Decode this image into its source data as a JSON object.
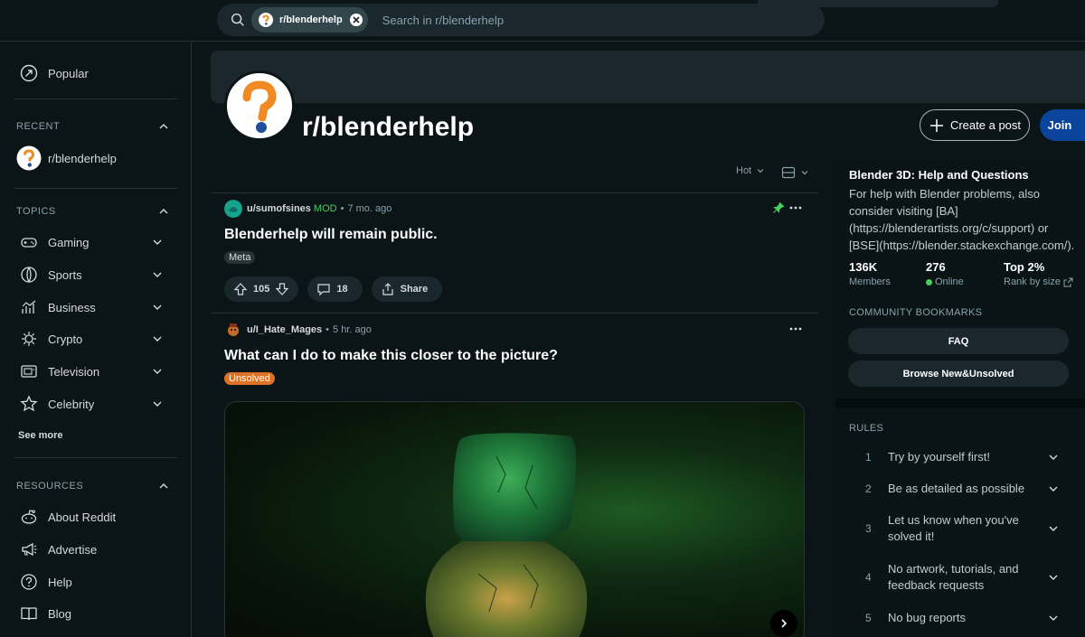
{
  "search": {
    "chip_label": "r/blenderhelp",
    "placeholder": "Search in r/blenderhelp"
  },
  "sidebar": {
    "popular_label": "Popular",
    "recent_heading": "RECENT",
    "recent_items": [
      {
        "label": "r/blenderhelp"
      }
    ],
    "topics_heading": "TOPICS",
    "topics": [
      {
        "label": "Gaming",
        "icon": "gamepad-icon"
      },
      {
        "label": "Sports",
        "icon": "sports-ball-icon"
      },
      {
        "label": "Business",
        "icon": "chart-icon"
      },
      {
        "label": "Crypto",
        "icon": "crypto-icon"
      },
      {
        "label": "Television",
        "icon": "television-icon"
      },
      {
        "label": "Celebrity",
        "icon": "star-icon"
      }
    ],
    "see_more": "See more",
    "resources_heading": "RESOURCES",
    "resources": [
      {
        "label": "About Reddit",
        "icon": "reddit-icon"
      },
      {
        "label": "Advertise",
        "icon": "megaphone-icon"
      },
      {
        "label": "Help",
        "icon": "help-icon"
      },
      {
        "label": "Blog",
        "icon": "book-icon"
      }
    ]
  },
  "subreddit": {
    "name": "r/blenderhelp",
    "create_post": "Create a post",
    "join": "Join"
  },
  "feed": {
    "sort": "Hot",
    "posts": [
      {
        "author": "u/sumofsines",
        "mod_badge": "MOD",
        "age": "7 mo. ago",
        "title": "Blenderhelp will remain public.",
        "flair": "Meta",
        "votes": "105",
        "comments": "18",
        "share": "Share"
      },
      {
        "author": "u/I_Hate_Mages",
        "age": "5 hr. ago",
        "title": "What can I do to make this closer to the picture?",
        "flair": "Unsolved"
      }
    ]
  },
  "about": {
    "title": "Blender 3D: Help and Questions",
    "description": "For help with Blender problems, also consider visiting [BA](https://blenderartists.org/c/support) or [BSE](https://blender.stackexchange.com/).",
    "members_value": "136K",
    "members_label": "Members",
    "online_value": "276",
    "online_label": "Online",
    "rank_value": "Top 2%",
    "rank_label": "Rank by size"
  },
  "bookmarks": {
    "heading": "COMMUNITY BOOKMARKS",
    "items": [
      "FAQ",
      "Browse New&Unsolved"
    ]
  },
  "rules": {
    "heading": "RULES",
    "items": [
      {
        "num": "1",
        "text": "Try by yourself first!"
      },
      {
        "num": "2",
        "text": "Be as detailed as possible"
      },
      {
        "num": "3",
        "text": "Let us know when you've solved it!"
      },
      {
        "num": "4",
        "text": "No artwork, tutorials, and feedback requests"
      },
      {
        "num": "5",
        "text": "No bug reports"
      }
    ]
  },
  "colors": {
    "background": "#0b1416",
    "join_button": "#0a449b",
    "mod_green": "#46d160",
    "unsolved_flair": "#dd7125"
  }
}
